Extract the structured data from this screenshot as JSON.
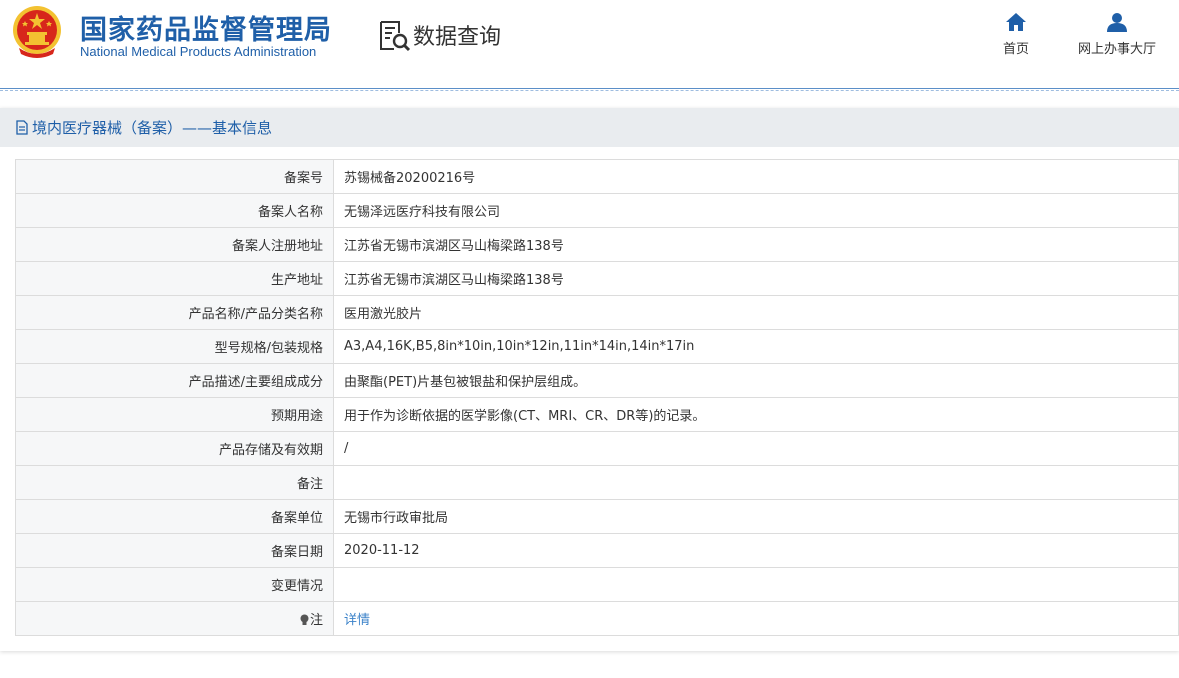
{
  "header": {
    "org_name_cn": "国家药品监督管理局",
    "org_name_en": "National Medical Products Administration",
    "query_label": "数据查询",
    "nav": [
      {
        "label": "首页",
        "icon": "home-icon"
      },
      {
        "label": "网上办事大厅",
        "icon": "user-icon"
      }
    ]
  },
  "section": {
    "title": "境内医疗器械（备案）——基本信息"
  },
  "rows": [
    {
      "label": "备案号",
      "value": "苏锡械备20200216号"
    },
    {
      "label": "备案人名称",
      "value": "无锡泽远医疗科技有限公司"
    },
    {
      "label": "备案人注册地址",
      "value": "江苏省无锡市滨湖区马山梅梁路138号"
    },
    {
      "label": "生产地址",
      "value": "江苏省无锡市滨湖区马山梅梁路138号"
    },
    {
      "label": "产品名称/产品分类名称",
      "value": "医用激光胶片"
    },
    {
      "label": "型号规格/包装规格",
      "value": "A3,A4,16K,B5,8in*10in,10in*12in,11in*14in,14in*17in"
    },
    {
      "label": "产品描述/主要组成成分",
      "value": "由聚酯(PET)片基包被银盐和保护层组成。"
    },
    {
      "label": "预期用途",
      "value": "用于作为诊断依据的医学影像(CT、MRI、CR、DR等)的记录。"
    },
    {
      "label": "产品存储及有效期",
      "value": "/"
    },
    {
      "label": "备注",
      "value": ""
    },
    {
      "label": "备案单位",
      "value": "无锡市行政审批局"
    },
    {
      "label": "备案日期",
      "value": "2020-11-12"
    },
    {
      "label": "变更情况",
      "value": ""
    },
    {
      "label": "注",
      "value": "详情"
    }
  ],
  "colors": {
    "brand_blue": "#1f5fa8",
    "link_blue": "#3b82c9",
    "emblem_red": "#d7261b",
    "emblem_gold": "#f3c231"
  }
}
